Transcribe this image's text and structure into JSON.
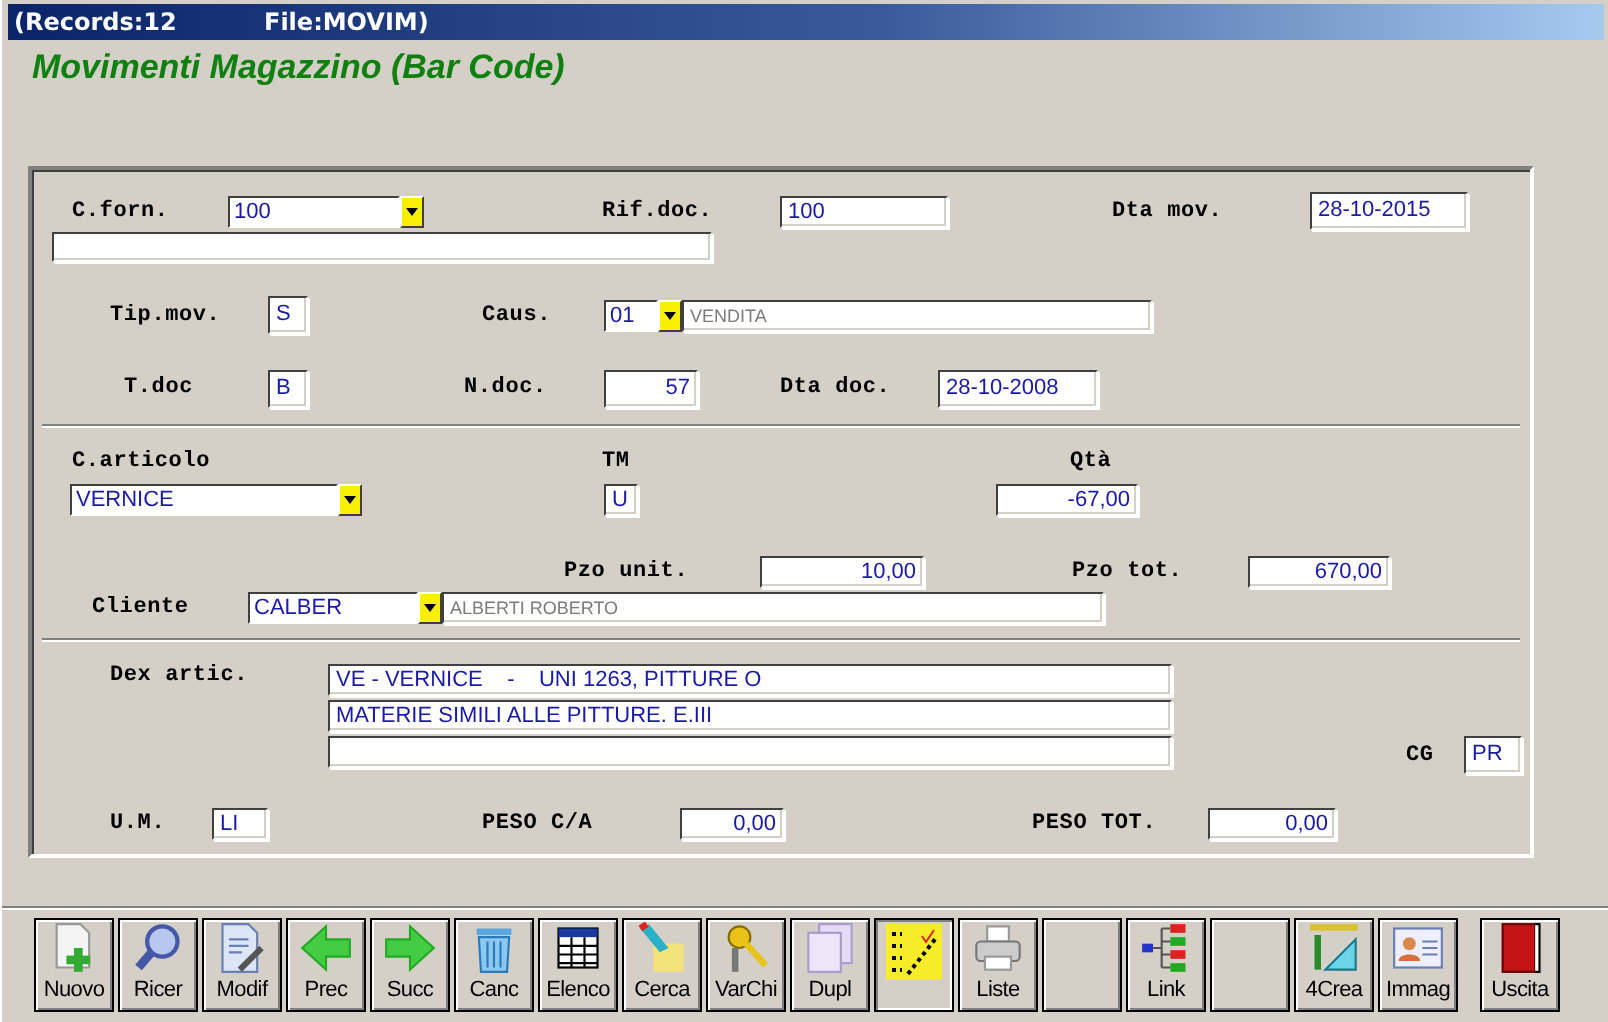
{
  "window": {
    "records": "(Records:12",
    "file": "File:MOVIM)"
  },
  "form_title": "Movimenti Magazzino (Bar Code)",
  "fields": {
    "c_forn": {
      "label": "C.forn.",
      "value": "100"
    },
    "rif_doc": {
      "label": "Rif.doc.",
      "value": "100"
    },
    "dta_mov": {
      "label": "Dta mov.",
      "value": "28-10-2015"
    },
    "tip_mov": {
      "label": "Tip.mov.",
      "value": "S"
    },
    "caus": {
      "label": "Caus.",
      "value": "01",
      "desc": "VENDITA"
    },
    "t_doc": {
      "label": "T.doc",
      "value": "B"
    },
    "n_doc": {
      "label": "N.doc.",
      "value": "57"
    },
    "dta_doc": {
      "label": "Dta doc.",
      "value": "28-10-2008"
    },
    "c_articolo": {
      "label": "C.articolo",
      "value": "VERNICE"
    },
    "tm": {
      "label": "TM",
      "value": "U"
    },
    "qta": {
      "label": "Qtà",
      "value": "-67,00"
    },
    "pzo_unit": {
      "label": "Pzo unit.",
      "value": "10,00"
    },
    "pzo_tot": {
      "label": "Pzo tot.",
      "value": "670,00"
    },
    "cliente": {
      "label": "Cliente",
      "value": "CALBER",
      "desc": "ALBERTI ROBERTO"
    },
    "dex_artic": {
      "label": "Dex artic.",
      "lines": [
        "VE - VERNICE    -    UNI 1263, PITTURE O",
        "MATERIE SIMILI ALLE PITTURE. E.III"
      ]
    },
    "cg": {
      "label": "CG",
      "value": "PR"
    },
    "um": {
      "label": "U.M.",
      "value": "LI"
    },
    "peso_ca": {
      "label": "PESO C/A",
      "value": "0,00"
    },
    "peso_tot": {
      "label": "PESO TOT.",
      "value": "0,00"
    }
  },
  "toolbar": [
    {
      "kind": "new",
      "label": "Nuovo",
      "selected": false
    },
    {
      "kind": "search",
      "label": "Ricer",
      "selected": false
    },
    {
      "kind": "edit",
      "label": "Modif",
      "selected": false
    },
    {
      "kind": "prev",
      "label": "Prec",
      "selected": false
    },
    {
      "kind": "next",
      "label": "Succ",
      "selected": false
    },
    {
      "kind": "delete",
      "label": "Canc",
      "selected": false
    },
    {
      "kind": "table",
      "label": "Elenco",
      "selected": false
    },
    {
      "kind": "find",
      "label": "Cerca",
      "selected": false
    },
    {
      "kind": "keys",
      "label": "VarChi",
      "selected": false
    },
    {
      "kind": "copy",
      "label": "Dupl",
      "selected": false
    },
    {
      "kind": "checklist",
      "selected": true
    },
    {
      "kind": "print",
      "label": "Liste",
      "selected": false
    },
    {
      "kind": "blank",
      "selected": false
    },
    {
      "kind": "link",
      "label": "Link",
      "selected": false
    },
    {
      "kind": "blank",
      "selected": false
    },
    {
      "kind": "tools",
      "label": "4Crea",
      "selected": false
    },
    {
      "kind": "card",
      "label": "Immag",
      "selected": false
    },
    {
      "kind": "exit",
      "label": "Uscita",
      "selected": false
    }
  ]
}
